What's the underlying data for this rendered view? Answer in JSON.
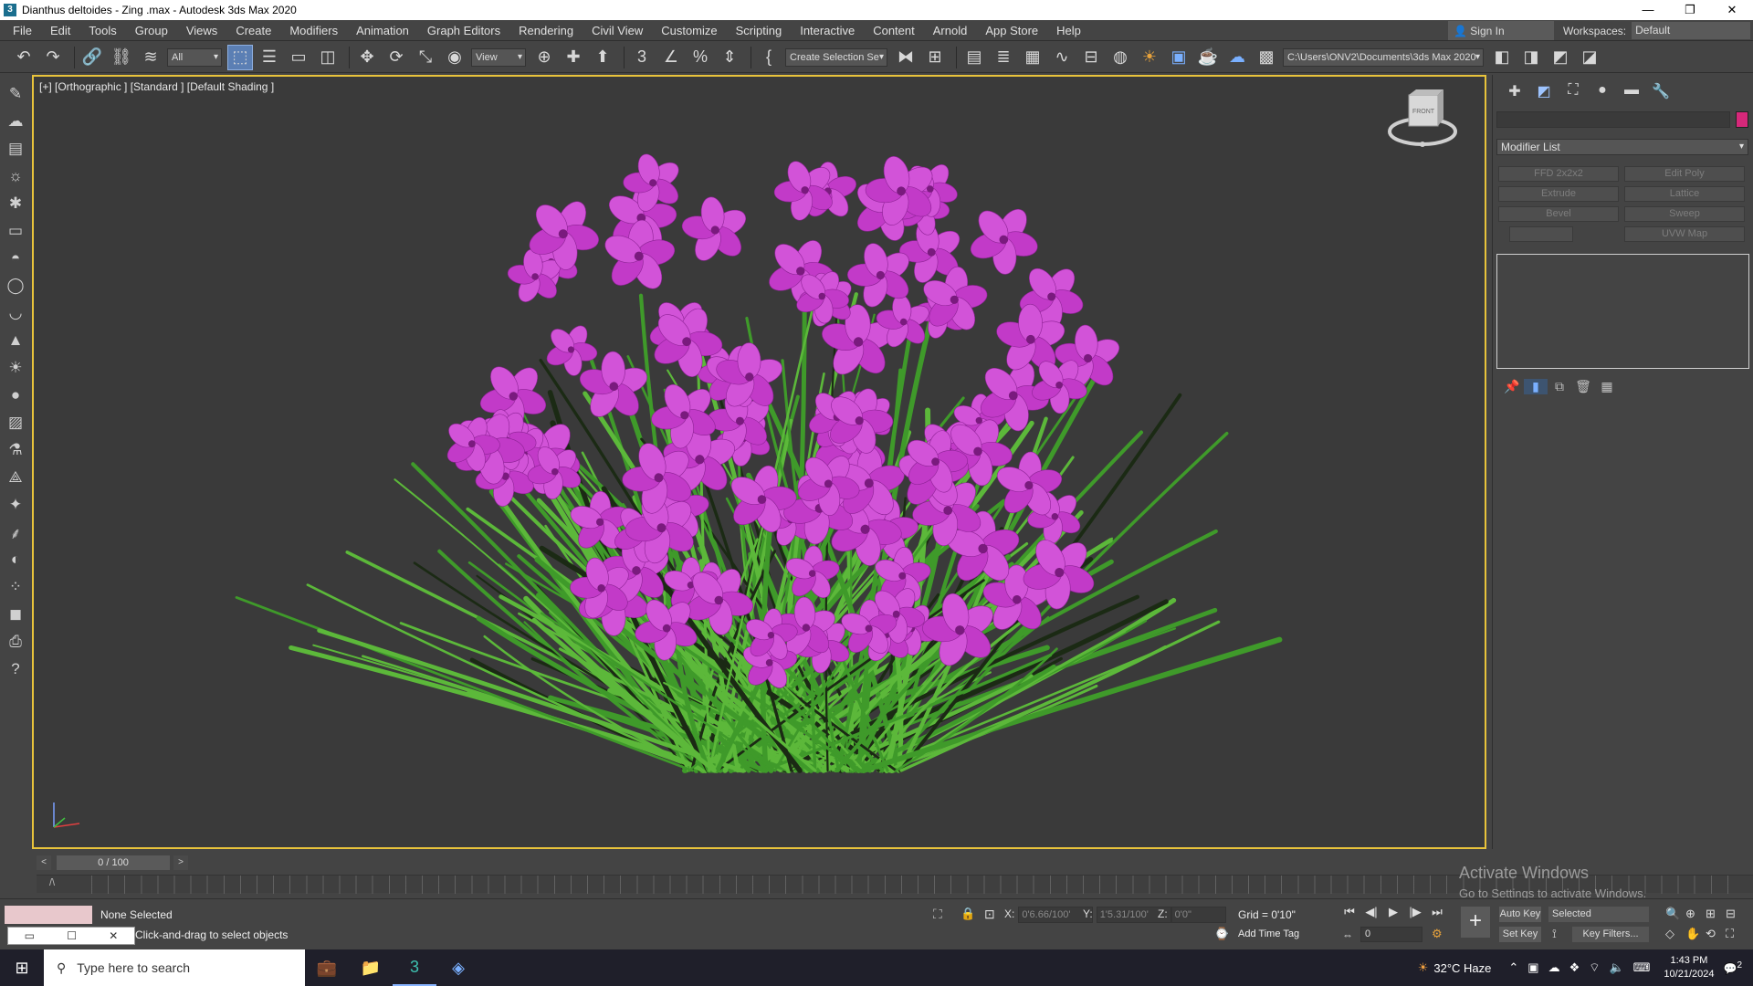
{
  "window": {
    "title": "Dianthus deltoides - Zing .max - Autodesk 3ds Max 2020",
    "controls": [
      "—",
      "❐",
      "✕"
    ]
  },
  "menu": [
    "File",
    "Edit",
    "Tools",
    "Group",
    "Views",
    "Create",
    "Modifiers",
    "Animation",
    "Graph Editors",
    "Rendering",
    "Civil View",
    "Customize",
    "Scripting",
    "Interactive",
    "Content",
    "Arnold",
    "App Store",
    "Help"
  ],
  "account": {
    "signin": "Sign In"
  },
  "workspace": {
    "label": "Workspaces:",
    "value": "Default"
  },
  "toolbar": {
    "filter": "All",
    "ref_coord": "View",
    "selection_set": "Create Selection Se",
    "project_path": "C:\\Users\\ONV2\\Documents\\3ds Max 2020"
  },
  "viewport": {
    "label": "[+] [Orthographic ] [Standard ] [Default Shading ]",
    "viewcube_face": "FRONT"
  },
  "command_panel": {
    "modifier_list": "Modifier List",
    "modifier_buttons": [
      "FFD 2x2x2",
      "Edit Poly",
      "Extrude",
      "Lattice",
      "Bevel",
      "Sweep",
      "",
      "UVW Map"
    ],
    "object_color": "#d6287a"
  },
  "timeline": {
    "frame": "0 / 100"
  },
  "status": {
    "selection": "None Selected",
    "prompt": "Click-and-drag to select objects",
    "x_label": "X:",
    "x": "0'6.66/100'",
    "y_label": "Y:",
    "y": "1'5.31/100'",
    "z_label": "Z:",
    "z": "0'0\"",
    "grid": "Grid = 0'10\"",
    "add_time_tag": "Add Time Tag",
    "auto_key": "Auto Key",
    "set_key": "Set Key",
    "key_mode": "Selected",
    "key_filters": "Key Filters...",
    "current_frame": "0"
  },
  "watermark": {
    "line1": "Activate Windows",
    "line2": "Go to Settings to activate Windows."
  },
  "taskbar": {
    "search_placeholder": "Type here to search",
    "weather": "32°C  Haze",
    "time": "1:43 PM",
    "date": "10/21/2024",
    "notification_count": "2"
  },
  "colors": {
    "viewport_border": "#e8c33b",
    "flower": "#c23ac8",
    "leaf": "#3f9a2a"
  }
}
